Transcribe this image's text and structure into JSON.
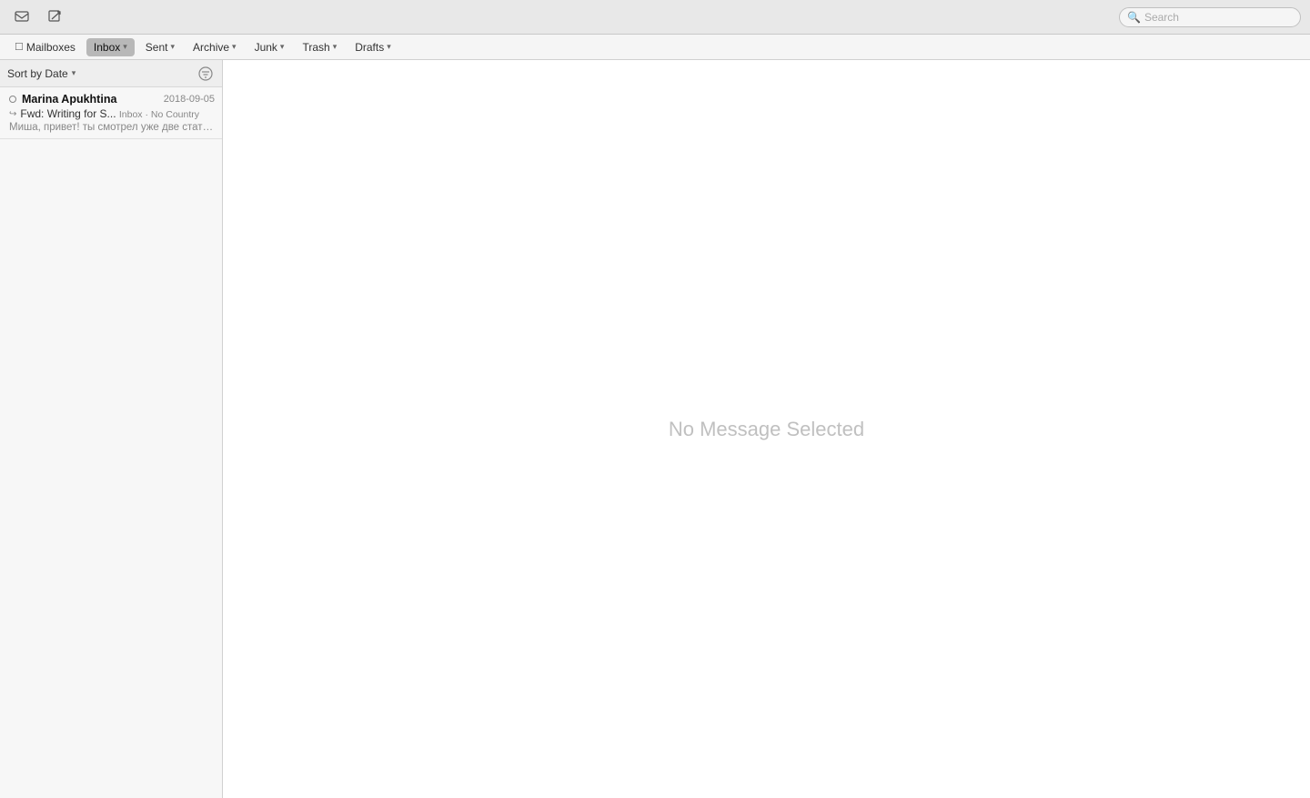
{
  "toolbar": {
    "inbox_icon_label": "✉",
    "compose_icon_label": "✏",
    "search_placeholder": "Search"
  },
  "nav": {
    "items": [
      {
        "id": "mailboxes",
        "label": "Mailboxes",
        "has_chevron": false,
        "active": false
      },
      {
        "id": "inbox",
        "label": "Inbox",
        "has_chevron": true,
        "active": true
      },
      {
        "id": "sent",
        "label": "Sent",
        "has_chevron": true,
        "active": false
      },
      {
        "id": "archive",
        "label": "Archive",
        "has_chevron": true,
        "active": false
      },
      {
        "id": "junk",
        "label": "Junk",
        "has_chevron": true,
        "active": false
      },
      {
        "id": "trash",
        "label": "Trash",
        "has_chevron": true,
        "active": false
      },
      {
        "id": "drafts",
        "label": "Drafts",
        "has_chevron": true,
        "active": false
      }
    ]
  },
  "email_list": {
    "sort_label": "Sort by Date",
    "emails": [
      {
        "id": "email-1",
        "sender": "Marina Apukhtina",
        "date": "2018-09-05",
        "subject": "Fwd: Writing for S...",
        "tag": "Inbox · No Country",
        "preview": "Миша, привет! ты смотрел уже две статьи от mr.Awysome? Можем опл...",
        "unread": false,
        "forwarded": true
      }
    ]
  },
  "detail": {
    "empty_label": "No Message Selected"
  }
}
